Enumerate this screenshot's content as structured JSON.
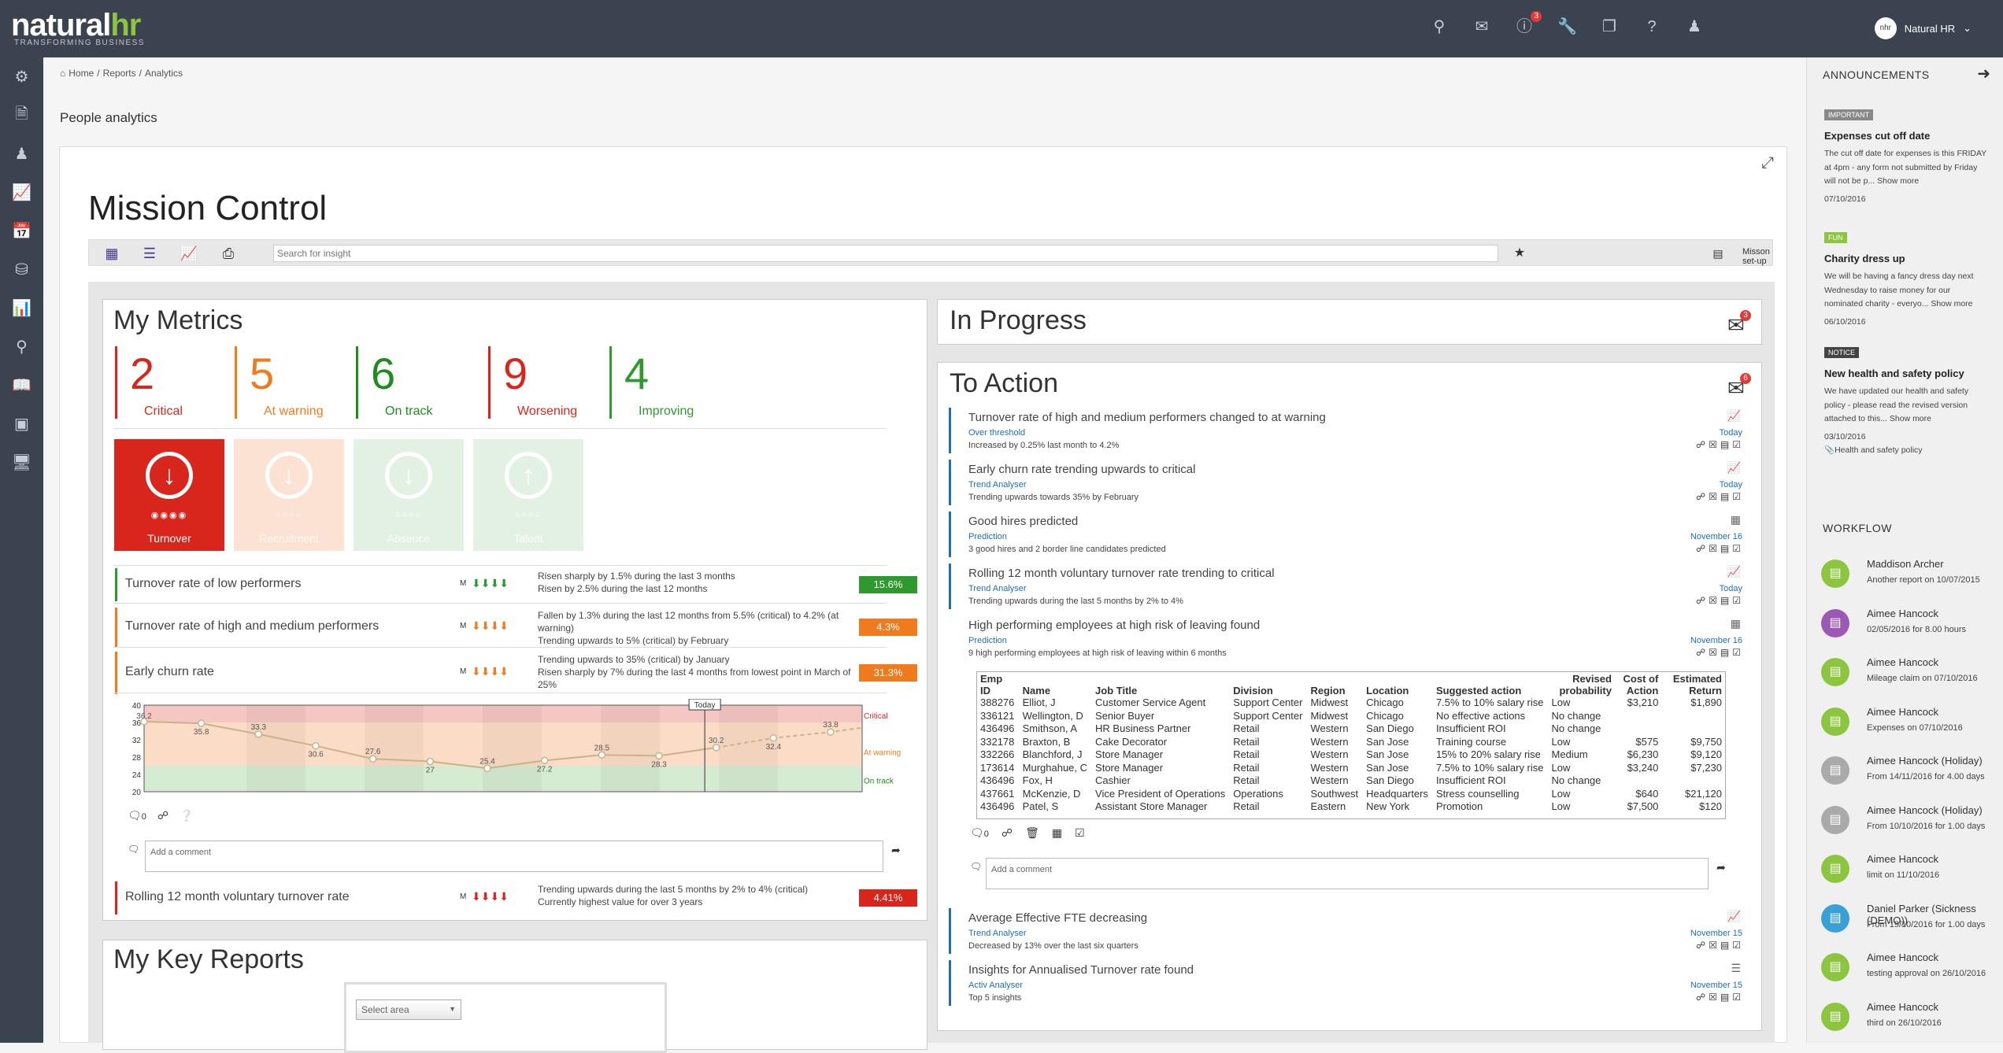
{
  "app": {
    "logo_main": "natural",
    "logo_hr": "hr",
    "logo_sub": "TRANSFORMING BUSINESS",
    "user": "Natural HR",
    "user_avatar": "nhr",
    "notif_count": "3"
  },
  "breadcrumb": {
    "home": "Home",
    "reports": "Reports",
    "analytics": "Analytics",
    "sep": "/"
  },
  "page_title": "People analytics",
  "mission": {
    "title": "Mission Control",
    "search_placeholder": "Search for insight",
    "setup": "Misson set-up"
  },
  "my_metrics": {
    "title": "My Metrics",
    "counts": [
      {
        "n": "2",
        "label": "Critical",
        "color": "#d9261c"
      },
      {
        "n": "5",
        "label": "At warning",
        "color": "#f07b1e"
      },
      {
        "n": "6",
        "label": "On track",
        "color": "#1e8c1e"
      },
      {
        "n": "9",
        "label": "Worsening",
        "color": "#d9261c"
      },
      {
        "n": "4",
        "label": "Improving",
        "color": "#2e9a2e"
      }
    ],
    "tiles": [
      {
        "label": "Turnover",
        "color": "#d9261c"
      },
      {
        "label": "Recruitment",
        "color": "#fbe2d3"
      },
      {
        "label": "Absence",
        "color": "#e3f1e3"
      },
      {
        "label": "Talent",
        "color": "#e3f1e3"
      }
    ],
    "rows": [
      {
        "title": "Turnover rate of low performers",
        "m": "M",
        "desc1": "Risen sharply by 1.5% during the last 3 months",
        "desc2": "Risen by 2.5% during the last 12 months",
        "desc3": "",
        "badge": "15.6%",
        "badge_color": "#2e9a2e",
        "border": "#2e9a2e"
      },
      {
        "title": "Turnover rate of high and medium performers",
        "m": "M",
        "desc1": "Fallen by 1.3% during the last 12 months from 5.5% (critical) to 4.2% (at warning)",
        "desc2": "Trending upwards to 5% (critical) by February",
        "desc3": "",
        "badge": "4.3%",
        "badge_color": "#f07b1e",
        "border": "#f07b1e"
      },
      {
        "title": "Early churn rate",
        "m": "M",
        "desc1": "Trending upwards to 35% (critical) by January",
        "desc2": "Risen sharply by 7% during the last 4 months from lowest point in March of 25%",
        "desc3": "",
        "badge": "31.3%",
        "badge_color": "#f07b1e",
        "border": "#f07b1e"
      },
      {
        "title": "Rolling 12 month voluntary turnover rate",
        "m": "M",
        "desc1": "Trending upwards during the last 5 months by 2% to 4% (critical)",
        "desc2": "Currently highest value for over 3 years",
        "desc3": "",
        "badge": "4.41%",
        "badge_color": "#d9261c",
        "border": "#d9261c"
      }
    ],
    "comment_placeholder": "Add a comment",
    "chat_count": "0"
  },
  "chart_data": {
    "type": "line",
    "x": [
      1,
      2,
      3,
      4,
      5,
      6,
      7,
      8,
      9,
      10,
      11,
      12
    ],
    "values": [
      36.2,
      35.8,
      33.3,
      30.6,
      27.6,
      27,
      25.4,
      27.2,
      28.5,
      28.3,
      30.2,
      32.4,
      33.8
    ],
    "labels": [
      "36.2",
      "35.8",
      "33.3",
      "30.6",
      "27.6",
      "27",
      "25.4",
      "27.2",
      "28.5",
      "28.3",
      "30.2",
      "32.4",
      "33.8"
    ],
    "ylim": [
      20,
      40
    ],
    "yticks": [
      "40",
      "36",
      "32",
      "28",
      "24",
      "20"
    ],
    "bands": {
      "critical": "Critical",
      "warning": "At warning",
      "ontrack": "On track"
    },
    "today_label": "Today"
  },
  "key_reports": {
    "title": "My Key Reports",
    "select": "Select area"
  },
  "in_progress": {
    "title": "In Progress",
    "count": "3"
  },
  "to_action": {
    "title": "To Action",
    "count": "6",
    "comment_placeholder": "Add a comment",
    "chat_count": "0",
    "items": [
      {
        "title": "Turnover rate of high and medium performers changed to at warning",
        "source": "Over threshold",
        "desc": "Increased by 0.25% last month to 4.2%",
        "date": "Today",
        "icon": "chart-icon"
      },
      {
        "title": "Early churn rate trending upwards to critical",
        "source": "Trend Analyser",
        "desc": "Trending upwards towards 35% by February",
        "date": "Today",
        "icon": "chart-icon"
      },
      {
        "title": "Good hires predicted",
        "source": "Prediction",
        "desc": "3 good hires and 2 border line candidates predicted",
        "date": "November 16",
        "icon": "grid-icon"
      },
      {
        "title": "Rolling 12 month voluntary turnover rate trending to critical",
        "source": "Trend Analyser",
        "desc": "Trending upwards during the last 5 months by 2% to 4%",
        "date": "Today",
        "icon": "chart-icon"
      },
      {
        "title": "High performing employees at high risk of leaving found",
        "source": "Prediction",
        "desc": "9 high performing employees at high risk of leaving within 6 months",
        "date": "November 16",
        "icon": "grid-icon"
      },
      {
        "title": "Average Effective FTE decreasing",
        "source": "Trend Analyser",
        "desc": "Decreased by 13% over the last six quarters",
        "date": "November 15",
        "icon": "chart-icon"
      },
      {
        "title": "Insights for Annualised Turnover rate found",
        "source": "Activ Analyser",
        "desc": "Top 5 insights",
        "date": "November 15",
        "icon": "list-icon"
      }
    ],
    "table": {
      "headers": [
        "Emp ID",
        "Name",
        "Job Title",
        "Division",
        "Region",
        "Location",
        "Suggested action",
        "Revised probability",
        "Cost of Action",
        "Estimated Return"
      ],
      "rows": [
        [
          "388276",
          "Elliot, J",
          "Customer Service Agent",
          "Support Center",
          "Midwest",
          "Chicago",
          "7.5% to 10% salary rise",
          "Low",
          "$3,210",
          "$1,890"
        ],
        [
          "336121",
          "Wellington, D",
          "Senior Buyer",
          "Support Center",
          "Midwest",
          "Chicago",
          "No effective actions",
          "No change",
          "",
          ""
        ],
        [
          "436496",
          "Smithson, A",
          "HR Business Partner",
          "Retail",
          "Western",
          "San Diego",
          "Insufficient ROI",
          "No change",
          "",
          ""
        ],
        [
          "332178",
          "Braxton, B",
          "Cake Decorator",
          "Retail",
          "Western",
          "San Jose",
          "Training course",
          "Low",
          "$575",
          "$9,750"
        ],
        [
          "332266",
          "Blanchford, J",
          "Store Manager",
          "Retail",
          "Western",
          "San Jose",
          "15% to 20% salary rise",
          "Medium",
          "$6,230",
          "$9,120"
        ],
        [
          "173614",
          "Murghahue, C",
          "Store Manager",
          "Retail",
          "Western",
          "San Jose",
          "7.5% to 10% salary rise",
          "Low",
          "$3,240",
          "$7,230"
        ],
        [
          "436496",
          "Fox, H",
          "Cashier",
          "Retail",
          "Western",
          "San Diego",
          "Insufficient ROI",
          "No change",
          "",
          ""
        ],
        [
          "437661",
          "McKenzie, D",
          "Vice President of Operations",
          "Operations",
          "Southwest",
          "Headquarters",
          "Stress counselling",
          "Low",
          "$640",
          "$21,120"
        ],
        [
          "436496",
          "Patel, S",
          "Assistant Store Manager",
          "Retail",
          "Eastern",
          "New York",
          "Promotion",
          "Low",
          "$7,500",
          "$120"
        ]
      ]
    }
  },
  "announcements": {
    "title": "ANNOUNCEMENTS",
    "items": [
      {
        "tag": "IMPORTANT",
        "tag_color": "#888888",
        "title": "Expenses cut off date",
        "body": "The cut off date for expenses is this FRIDAY at 4pm - any form not submitted by Friday will not be p... Show more",
        "date": "07/10/2016"
      },
      {
        "tag": "FUN",
        "tag_color": "#8cc63f",
        "title": "Charity dress up",
        "body": "We will be having a fancy dress day next Wednesday to raise money for our nominated charity - everyo... Show more",
        "date": "06/10/2016"
      },
      {
        "tag": "NOTICE",
        "tag_color": "#444444",
        "title": "New health and safety policy",
        "body": "We have updated our health and safety policy - please read the revised version attached to this... Show more",
        "date": "03/10/2016",
        "attach": "Health and safety policy"
      }
    ]
  },
  "workflow": {
    "title": "WORKFLOW",
    "items": [
      {
        "name": "Maddison Archer",
        "sub": "Another report on 10/07/2015",
        "color": "#8cc63f"
      },
      {
        "name": "Aimee Hancock",
        "sub": "02/05/2016 for 8.00 hours",
        "color": "#9b59b6"
      },
      {
        "name": "Aimee Hancock",
        "sub": "Mileage claim on 07/10/2016",
        "color": "#8cc63f"
      },
      {
        "name": "Aimee Hancock",
        "sub": "Expenses on 07/10/2016",
        "color": "#8cc63f"
      },
      {
        "name": "Aimee Hancock (Holiday)",
        "sub": "From 14/11/2016 for 4.00 days",
        "color": "#aaaaaa"
      },
      {
        "name": "Aimee Hancock (Holiday)",
        "sub": "From 10/10/2016 for 1.00 days",
        "color": "#aaaaaa"
      },
      {
        "name": "Aimee Hancock",
        "sub": "limit on 11/10/2016",
        "color": "#8cc63f"
      },
      {
        "name": "Daniel Parker (Sickness (DEMO))",
        "sub": "From 19/10/2016 for 1.00 days",
        "color": "#3aa0d8"
      },
      {
        "name": "Aimee Hancock",
        "sub": "testing approval on 26/10/2016",
        "color": "#8cc63f"
      },
      {
        "name": "Aimee Hancock",
        "sub": "third on 26/10/2016",
        "color": "#8cc63f"
      }
    ]
  }
}
